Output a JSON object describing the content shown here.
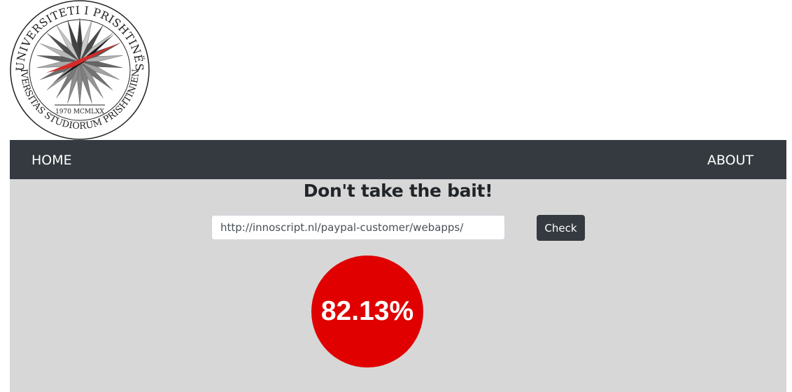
{
  "logo": {
    "ring_text_top": "UNIVERSITETI I PRISHTINËS",
    "ring_text_bottom": "UNIVERSITAS STUDIORUM PRISHTINIENSIS",
    "year": "1970 MCMLXX"
  },
  "nav": {
    "home": "HOME",
    "about": "ABOUT"
  },
  "main": {
    "title": "Don't take the bait!",
    "url_value": "http://innoscript.nl/paypal-customer/webapps/",
    "check_label": "Check",
    "result_percent": "82.13%",
    "result_value": 82.13
  },
  "colors": {
    "navbar": "#343a40",
    "background": "#d7d7d7",
    "result_circle": "#e00000"
  }
}
